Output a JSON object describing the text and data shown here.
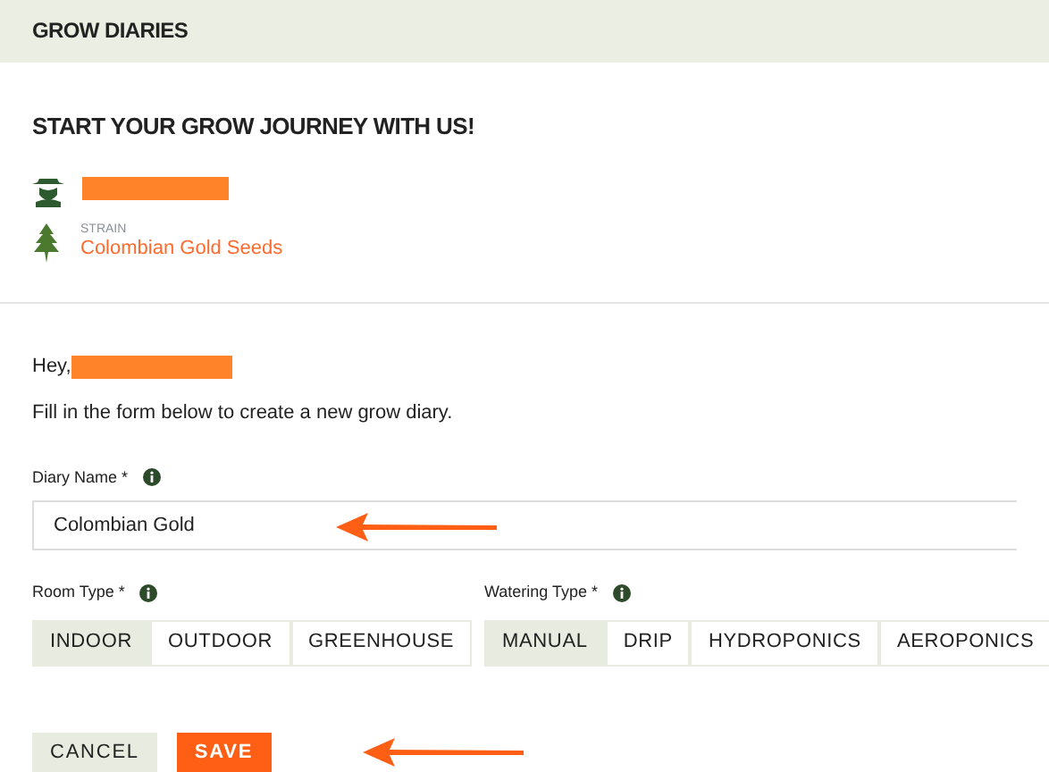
{
  "header": {
    "title": "GROW DIARIES"
  },
  "heading": "START YOUR GROW JOURNEY WITH US!",
  "strain": {
    "label": "STRAIN",
    "name": "Colombian Gold Seeds"
  },
  "greeting": "Hey,",
  "intro": "Fill in the form below to create a new grow diary.",
  "diary_name": {
    "label": "Diary Name *",
    "value": "Colombian Gold"
  },
  "room_type": {
    "label": "Room Type *",
    "options": [
      {
        "label": "INDOOR",
        "selected": true
      },
      {
        "label": "OUTDOOR",
        "selected": false
      },
      {
        "label": "GREENHOUSE",
        "selected": false
      }
    ]
  },
  "watering_type": {
    "label": "Watering Type *",
    "options": [
      {
        "label": "MANUAL",
        "selected": true
      },
      {
        "label": "DRIP",
        "selected": false
      },
      {
        "label": "HYDROPONICS",
        "selected": false
      },
      {
        "label": "AEROPONICS",
        "selected": false
      }
    ]
  },
  "buttons": [
    {
      "label": "CANCEL",
      "kind": "secondary"
    },
    {
      "label": "SAVE",
      "kind": "primary"
    }
  ]
}
